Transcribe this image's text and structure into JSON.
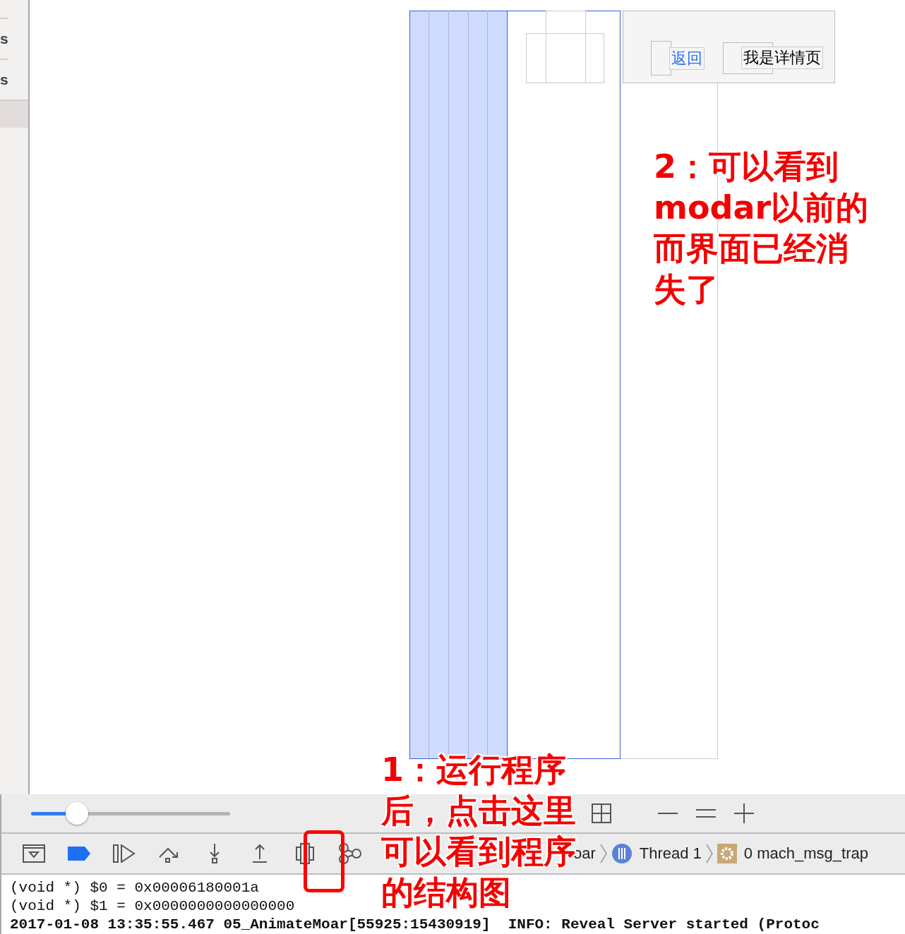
{
  "sidebar": {
    "items": [
      "s",
      "s"
    ]
  },
  "view_debugger": {
    "back_button": "返回",
    "nav_title": "我是详情页"
  },
  "zoom_bar": {
    "slider": {
      "level": 0.23
    }
  },
  "debug_bar": {
    "breadcrumbs": [
      {
        "kind": "text",
        "label": "oar"
      },
      {
        "kind": "thread",
        "label": "Thread 1"
      },
      {
        "kind": "frame",
        "label": "0 mach_msg_trap"
      }
    ]
  },
  "console": {
    "lines": [
      {
        "text": "(void *) $0 = 0x00006180001a",
        "bold": false
      },
      {
        "text": "(void *) $1 = 0x0000000000000000",
        "bold": false
      },
      {
        "text": "2017-01-08 13:35:55.467 05_AnimateMoar[55925:15430919]  INFO: Reveal Server started (Protoc",
        "bold": true
      }
    ]
  },
  "annotations": [
    {
      "lines": [
        "2：可以看到",
        "modar以前的",
        "而界面已经消",
        "失了"
      ]
    },
    {
      "lines": [
        "1：运行程序",
        "后，点击这里",
        "可以看到程序",
        "的结构图"
      ]
    }
  ]
}
